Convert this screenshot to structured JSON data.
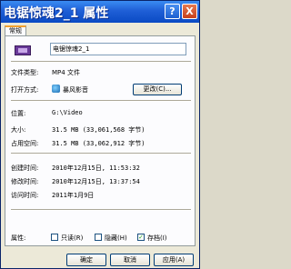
{
  "window": {
    "title": "电锯惊魂2_1 属性"
  },
  "tabs": [
    {
      "label": "常规"
    }
  ],
  "file": {
    "name": "电锯惊魂2_1",
    "icon": "video-file-icon"
  },
  "general": {
    "type_label": "文件类型:",
    "type_value": "MP4 文件",
    "open_label": "打开方式:",
    "open_app": "暴风影音",
    "open_app_icon": "player-app-icon",
    "change_button": "更改(C)...",
    "location_label": "位置:",
    "location_value": "G:\\Video",
    "size_label": "大小:",
    "size_value": "31.5 MB (33,061,568 字节)",
    "disk_label": "占用空间:",
    "disk_value": "31.5 MB (33,062,912 字节)",
    "created_label": "创建时间:",
    "created_value": "2010年12月15日, 11:53:32",
    "modified_label": "修改时间:",
    "modified_value": "2010年12月15日, 13:37:54",
    "accessed_label": "访问时间:",
    "accessed_value": "2011年1月9日",
    "attr_label": "属性:",
    "attr_readonly": "只读(R)",
    "attr_hidden": "隐藏(H)",
    "attr_archive": "存档(I)",
    "readonly_checked": false,
    "hidden_checked": false,
    "archive_checked": true
  },
  "footer": {
    "ok": "确定",
    "cancel": "取消",
    "apply": "应用(A)"
  },
  "titlebar_buttons": {
    "help": "?",
    "close": "X"
  }
}
